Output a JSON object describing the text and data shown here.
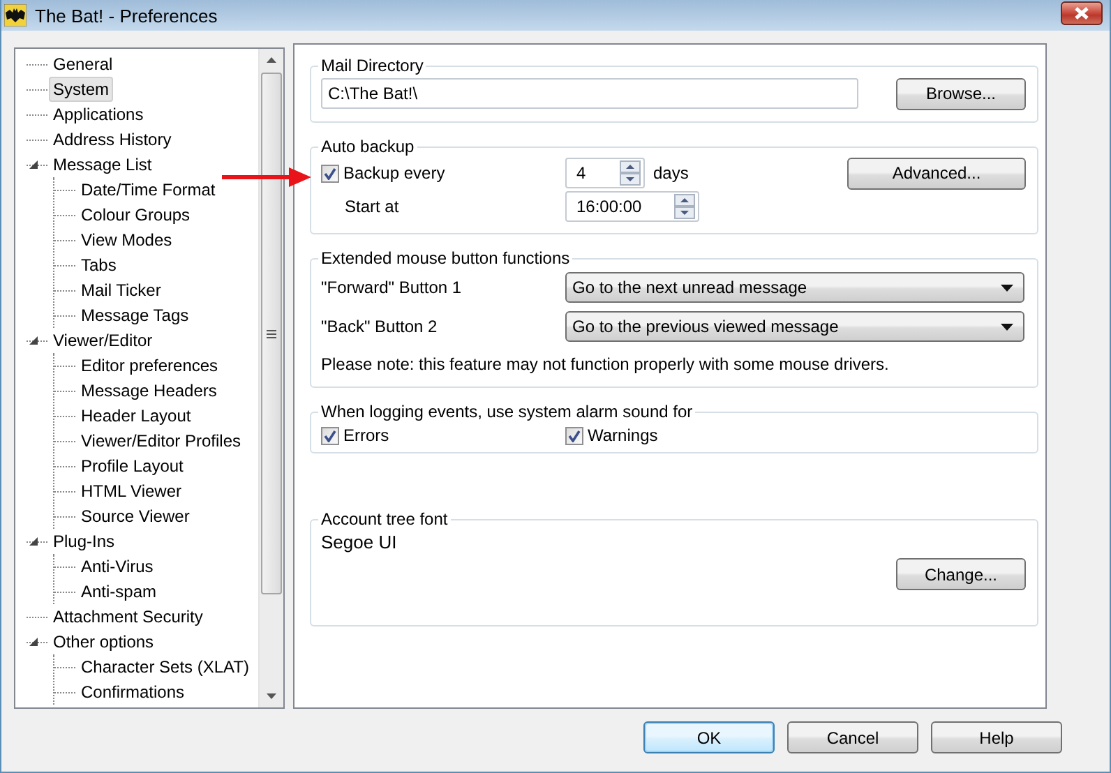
{
  "window": {
    "title": "The Bat! - Preferences"
  },
  "tree": [
    {
      "label": "General",
      "selected": false
    },
    {
      "label": "System",
      "selected": true
    },
    {
      "label": "Applications",
      "selected": false
    },
    {
      "label": "Address History",
      "selected": false
    },
    {
      "label": "Message List",
      "selected": false,
      "expanded": true,
      "children": [
        {
          "label": "Date/Time Format",
          "selected": false
        },
        {
          "label": "Colour Groups",
          "selected": false
        },
        {
          "label": "View Modes",
          "selected": false
        },
        {
          "label": "Tabs",
          "selected": false
        },
        {
          "label": "Mail Ticker",
          "selected": false
        },
        {
          "label": "Message Tags",
          "selected": false
        }
      ]
    },
    {
      "label": "Viewer/Editor",
      "selected": false,
      "expanded": true,
      "children": [
        {
          "label": "Editor preferences",
          "selected": false
        },
        {
          "label": "Message Headers",
          "selected": false
        },
        {
          "label": "Header Layout",
          "selected": false
        },
        {
          "label": "Viewer/Editor Profiles",
          "selected": false
        },
        {
          "label": "Profile Layout",
          "selected": false
        },
        {
          "label": "HTML Viewer",
          "selected": false
        },
        {
          "label": "Source Viewer",
          "selected": false
        }
      ]
    },
    {
      "label": "Plug-Ins",
      "selected": false,
      "expanded": true,
      "children": [
        {
          "label": "Anti-Virus",
          "selected": false
        },
        {
          "label": "Anti-spam",
          "selected": false
        }
      ]
    },
    {
      "label": "Attachment Security",
      "selected": false
    },
    {
      "label": "Other options",
      "selected": false,
      "expanded": true,
      "children": [
        {
          "label": "Character Sets (XLAT)",
          "selected": false
        },
        {
          "label": "Confirmations",
          "selected": false
        }
      ]
    }
  ],
  "mail_directory": {
    "title": "Mail Directory",
    "value": "C:\\The Bat!\\",
    "button": "Browse..."
  },
  "auto_backup": {
    "title": "Auto backup",
    "backup_every": {
      "label": "Backup every",
      "checked": true
    },
    "days": {
      "value": "4",
      "unit": "days"
    },
    "start_at": {
      "label": "Start at",
      "value": "16:00:00"
    },
    "button": "Advanced..."
  },
  "mouse_buttons": {
    "title": "Extended mouse button functions",
    "rows": [
      {
        "label": "\"Forward\" Button 1",
        "value": "Go to the next unread message"
      },
      {
        "label": "\"Back\" Button 2",
        "value": "Go to the previous viewed message"
      }
    ],
    "note": "Please note: this feature may not function properly with some mouse drivers."
  },
  "logging": {
    "title": "When logging events, use system alarm sound for",
    "options": [
      {
        "label": "Errors",
        "checked": true
      },
      {
        "label": "Warnings",
        "checked": true
      }
    ]
  },
  "account_font": {
    "title": "Account tree font",
    "value": "Segoe UI",
    "button": "Change..."
  },
  "buttons": [
    {
      "label": "OK",
      "default": true
    },
    {
      "label": "Cancel",
      "default": false
    },
    {
      "label": "Help",
      "default": false
    }
  ]
}
